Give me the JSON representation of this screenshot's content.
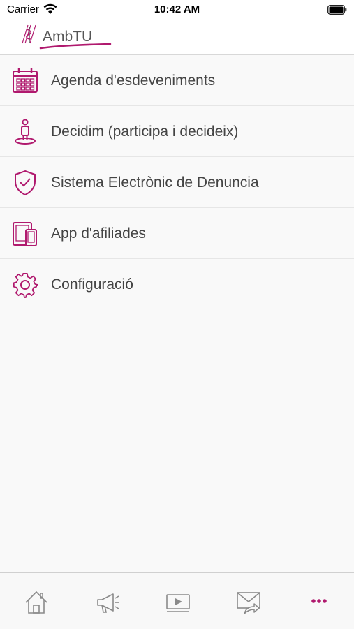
{
  "status_bar": {
    "carrier": "Carrier",
    "time": "10:42 AM"
  },
  "header": {
    "logo_text": "AmbTU"
  },
  "menu": {
    "items": [
      {
        "label": "Agenda d'esdeveniments",
        "icon": "calendar-icon"
      },
      {
        "label": "Decidim (participa i decideix)",
        "icon": "person-icon"
      },
      {
        "label": "Sistema Electrònic de Denuncia",
        "icon": "shield-check-icon"
      },
      {
        "label": "App d'afiliades",
        "icon": "devices-icon"
      },
      {
        "label": "Configuració",
        "icon": "gear-icon"
      }
    ]
  },
  "tab_bar": {
    "tabs": [
      {
        "icon": "home-icon",
        "active": false
      },
      {
        "icon": "megaphone-icon",
        "active": false
      },
      {
        "icon": "video-player-icon",
        "active": false
      },
      {
        "icon": "mail-forward-icon",
        "active": false
      },
      {
        "icon": "more-icon",
        "active": true
      }
    ]
  },
  "colors": {
    "accent": "#b0196e",
    "icon_gray": "#8a8a8a",
    "text": "#444444"
  }
}
